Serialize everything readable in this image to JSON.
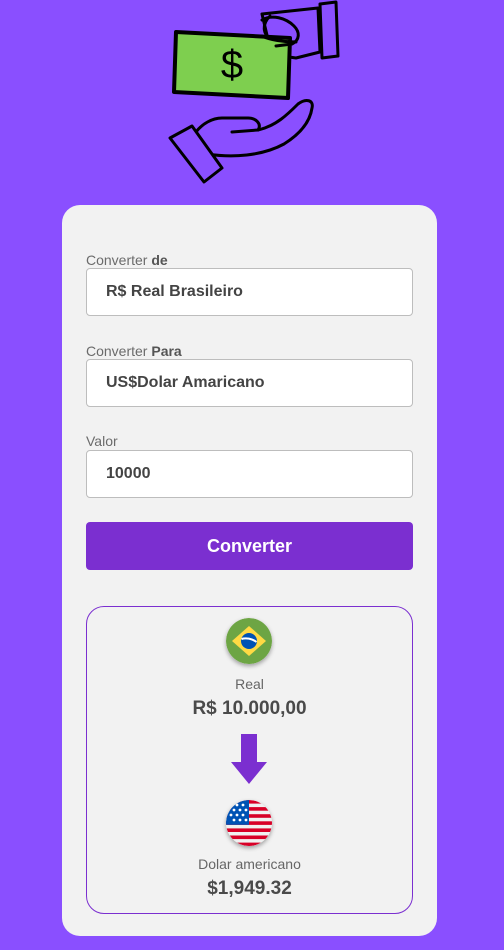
{
  "form": {
    "from_label_prefix": "Converter ",
    "from_label_strong": "de",
    "from_value": "R$ Real Brasileiro",
    "to_label_prefix": "Converter ",
    "to_label_strong": "Para",
    "to_value": "US$Dolar Amaricano",
    "amount_label": "Valor",
    "amount_value": "10000",
    "convert_button": "Converter"
  },
  "result": {
    "from_currency": "Real",
    "from_amount": "R$ 10.000,00",
    "to_currency": "Dolar americano",
    "to_amount": "$1,949.32"
  },
  "icons": {
    "hero": "money-exchange-icon",
    "from_flag": "brazil-flag-icon",
    "to_flag": "usa-flag-icon",
    "arrow": "arrow-down-icon"
  },
  "colors": {
    "background": "#8a4fff",
    "accent": "#7b2fd0",
    "card": "#f2f2f2",
    "money": "#7ecf4f"
  }
}
